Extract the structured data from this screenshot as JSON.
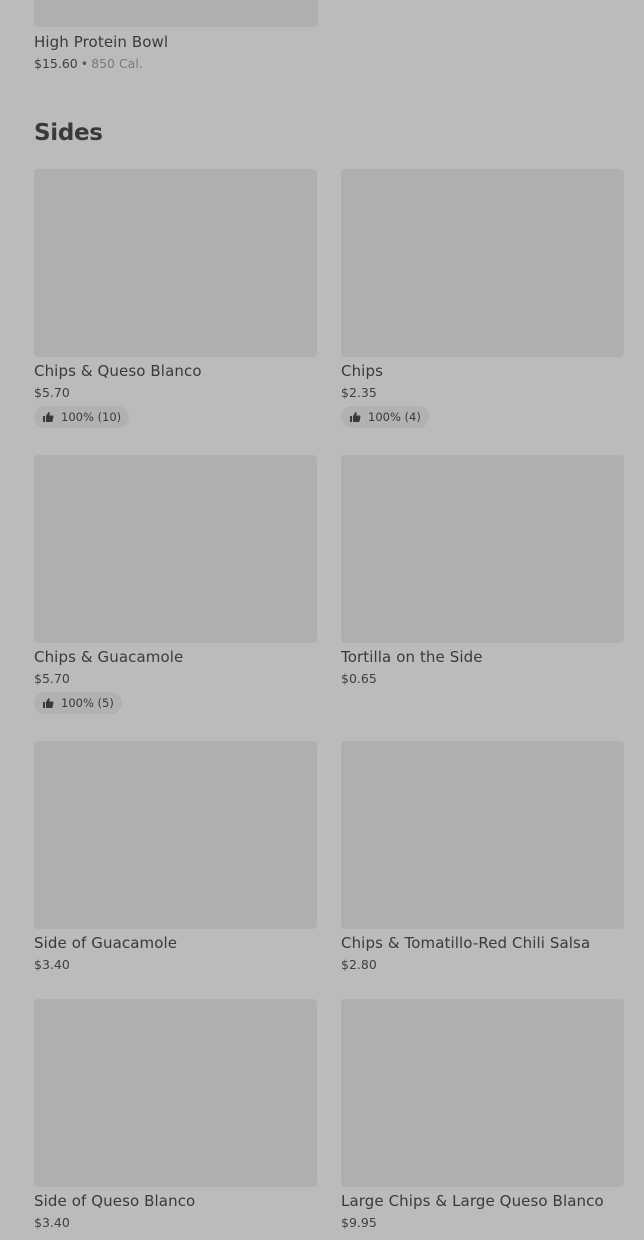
{
  "top_item": {
    "name": "High Protein Bowl",
    "price": "$15.60",
    "separator": "•",
    "calories": "850 Cal."
  },
  "section": {
    "title": "Sides"
  },
  "items": [
    {
      "name": "Chips & Queso Blanco",
      "price": "$5.70",
      "rating": "100% (10)"
    },
    {
      "name": "Chips",
      "price": "$2.35",
      "rating": "100% (4)"
    },
    {
      "name": "Chips & Guacamole",
      "price": "$5.70",
      "rating": "100% (5)"
    },
    {
      "name": "Tortilla on the Side",
      "price": "$0.65"
    },
    {
      "name": "Side of Guacamole",
      "price": "$3.40"
    },
    {
      "name": "Chips & Tomatillo-Red Chili Salsa",
      "price": "$2.80"
    },
    {
      "name": "Side of Queso Blanco",
      "price": "$3.40"
    },
    {
      "name": "Large Chips & Large Queso Blanco",
      "price": "$9.95"
    }
  ],
  "icons": {
    "rating": "thumbs-up-icon"
  },
  "colors": {
    "background": "#bbbbbb",
    "image_placeholder": "#afafaf",
    "text": "#3a3a3a"
  }
}
